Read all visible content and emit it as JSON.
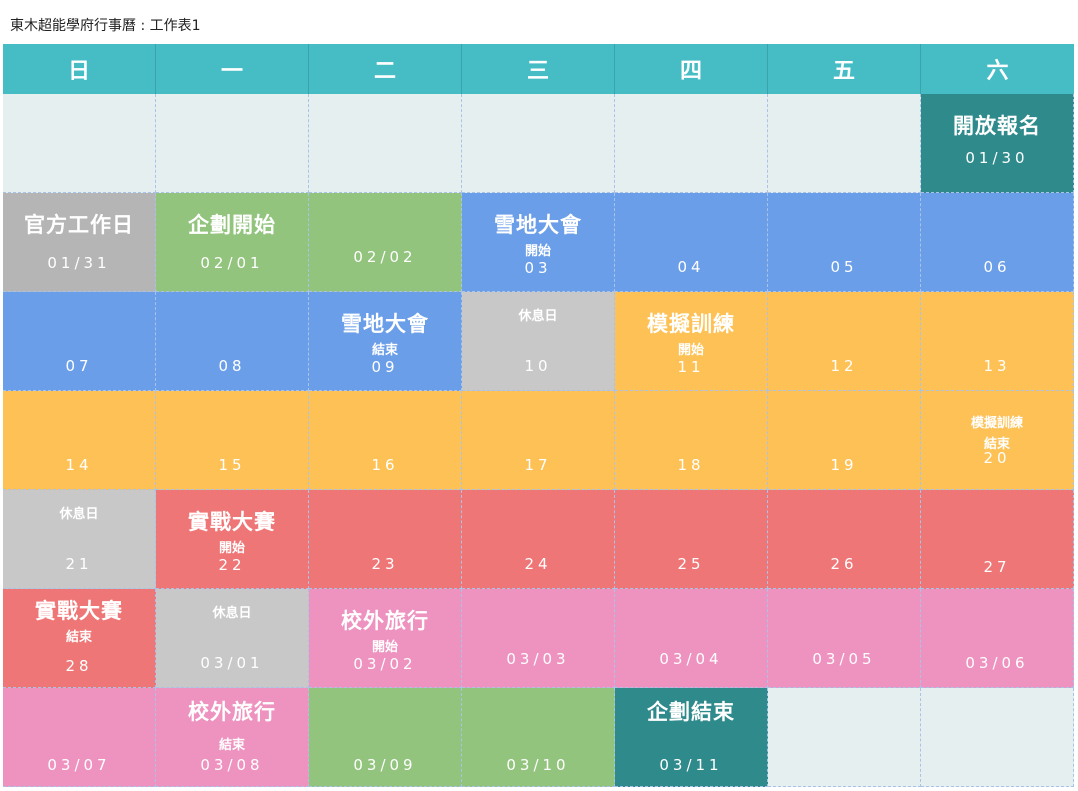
{
  "sheet_title": "東木超能學府行事曆 : 工作表1",
  "weekdays": [
    "日",
    "一",
    "二",
    "三",
    "四",
    "五",
    "六"
  ],
  "cells": {
    "r1": [
      {
        "date": ""
      },
      {
        "date": ""
      },
      {
        "date": ""
      },
      {
        "date": ""
      },
      {
        "date": ""
      },
      {
        "date": ""
      },
      {
        "title": "開放報名",
        "date": "01/30"
      }
    ],
    "r2": [
      {
        "title": "官方工作日",
        "date": "01/31"
      },
      {
        "title": "企劃開始",
        "date": "02/01"
      },
      {
        "date": "02/02"
      },
      {
        "title": "雪地大會",
        "sub": "開始",
        "date": "03"
      },
      {
        "date": "04"
      },
      {
        "date": "05"
      },
      {
        "date": "06"
      }
    ],
    "r3": [
      {
        "date": "07"
      },
      {
        "date": "08"
      },
      {
        "title": "雪地大會",
        "sub": "結束",
        "date": "09"
      },
      {
        "small": "休息日",
        "date": "10"
      },
      {
        "title": "模擬訓練",
        "sub": "開始",
        "date": "11"
      },
      {
        "date": "12"
      },
      {
        "date": "13"
      }
    ],
    "r4": [
      {
        "date": "14"
      },
      {
        "date": "15"
      },
      {
        "date": "16"
      },
      {
        "date": "17"
      },
      {
        "date": "18"
      },
      {
        "date": "19"
      },
      {
        "small": "模擬訓練",
        "small2": "結束",
        "date": "20"
      }
    ],
    "r5": [
      {
        "small": "休息日",
        "date": "21"
      },
      {
        "title": "實戰大賽",
        "sub": "開始",
        "date": "22"
      },
      {
        "date": "23"
      },
      {
        "date": "24"
      },
      {
        "date": "25"
      },
      {
        "date": "26"
      },
      {
        "date": "27"
      }
    ],
    "r6": [
      {
        "title": "實戰大賽",
        "sub": "結束",
        "date": "28"
      },
      {
        "small": "休息日",
        "date": "03/01"
      },
      {
        "title": "校外旅行",
        "sub": "開始",
        "date": "03/02"
      },
      {
        "date": "03/03"
      },
      {
        "date": "03/04"
      },
      {
        "date": "03/05"
      },
      {
        "date": "03/06"
      }
    ],
    "r7": [
      {
        "date": "03/07"
      },
      {
        "title": "校外旅行",
        "sub": "結束",
        "date": "03/08"
      },
      {
        "date": "03/09"
      },
      {
        "date": "03/10"
      },
      {
        "title": "企劃結束",
        "date": "03/11"
      },
      {
        "date": ""
      },
      {
        "date": ""
      }
    ]
  },
  "colors": {
    "header": "#46bcc5",
    "empty": "#e5eff0",
    "teal": "#2f8a8c",
    "gray": "#b5b5b5",
    "light_gray": "#c8c8c8",
    "green": "#92c47e",
    "blue": "#6b9ee8",
    "orange": "#fec155",
    "red": "#ef7676",
    "pink": "#ee93bf"
  }
}
